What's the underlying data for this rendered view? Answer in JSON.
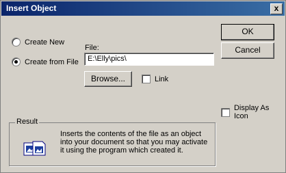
{
  "window": {
    "title": "Insert Object",
    "close_glyph": "x"
  },
  "options": {
    "create_new": "Create New",
    "create_from_file": "Create from File",
    "selected": "create_from_file"
  },
  "file": {
    "label": "File:",
    "value": "E:\\Elly\\pics\\"
  },
  "buttons": {
    "ok": "OK",
    "cancel": "Cancel",
    "browse": "Browse..."
  },
  "checkboxes": {
    "link": "Link",
    "display_as_icon": "Display As Icon"
  },
  "result": {
    "title": "Result",
    "text": "Inserts the contents of the file as an object into your document so that you may activate it using the program which created it."
  }
}
